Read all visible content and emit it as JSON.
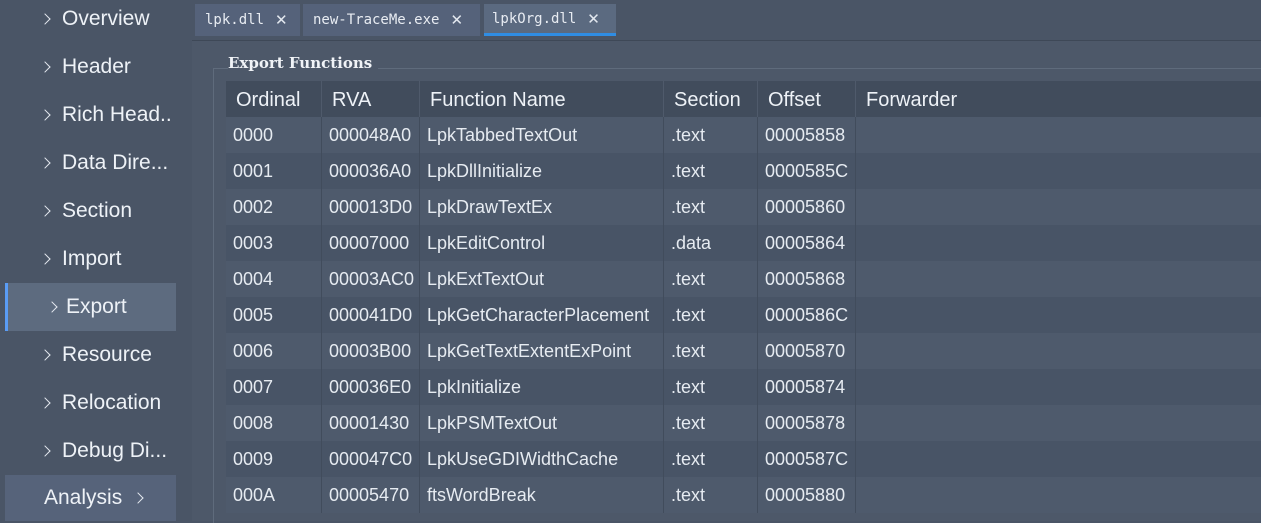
{
  "sidebar": {
    "items": [
      {
        "label": "Overview"
      },
      {
        "label": "Header"
      },
      {
        "label": "Rich Head.."
      },
      {
        "label": "Data Dire..."
      },
      {
        "label": "Section"
      },
      {
        "label": "Import"
      },
      {
        "label": "Export",
        "active": true
      },
      {
        "label": "Resource"
      },
      {
        "label": "Relocation"
      },
      {
        "label": "Debug Di..."
      }
    ],
    "analysis_label": "Analysis"
  },
  "tabs": [
    {
      "label": "lpk.dll"
    },
    {
      "label": "new-TraceMe.exe"
    },
    {
      "label": "lpkOrg.dll",
      "active": true
    }
  ],
  "tab_close_glyph": "✕",
  "export": {
    "title": "Export Functions",
    "columns": [
      "Ordinal",
      "RVA",
      "Function Name",
      "Section",
      "Offset",
      "Forwarder"
    ],
    "rows": [
      [
        "0000",
        "000048A0",
        "LpkTabbedTextOut",
        ".text",
        "00005858",
        ""
      ],
      [
        "0001",
        "000036A0",
        "LpkDllInitialize",
        ".text",
        "0000585C",
        ""
      ],
      [
        "0002",
        "000013D0",
        "LpkDrawTextEx",
        ".text",
        "00005860",
        ""
      ],
      [
        "0003",
        "00007000",
        "LpkEditControl",
        ".data",
        "00005864",
        ""
      ],
      [
        "0004",
        "00003AC0",
        "LpkExtTextOut",
        ".text",
        "00005868",
        ""
      ],
      [
        "0005",
        "000041D0",
        "LpkGetCharacterPlacement",
        ".text",
        "0000586C",
        ""
      ],
      [
        "0006",
        "00003B00",
        "LpkGetTextExtentExPoint",
        ".text",
        "00005870",
        ""
      ],
      [
        "0007",
        "000036E0",
        "LpkInitialize",
        ".text",
        "00005874",
        ""
      ],
      [
        "0008",
        "00001430",
        "LpkPSMTextOut",
        ".text",
        "00005878",
        ""
      ],
      [
        "0009",
        "000047C0",
        "LpkUseGDIWidthCache",
        ".text",
        "0000587C",
        ""
      ],
      [
        "000A",
        "00005470",
        "ftsWordBreak",
        ".text",
        "00005880",
        ""
      ]
    ]
  },
  "colors": {
    "background": "#4a5566",
    "active_accent": "#2f8de4",
    "sidebar_active": "#5d6b7f"
  }
}
